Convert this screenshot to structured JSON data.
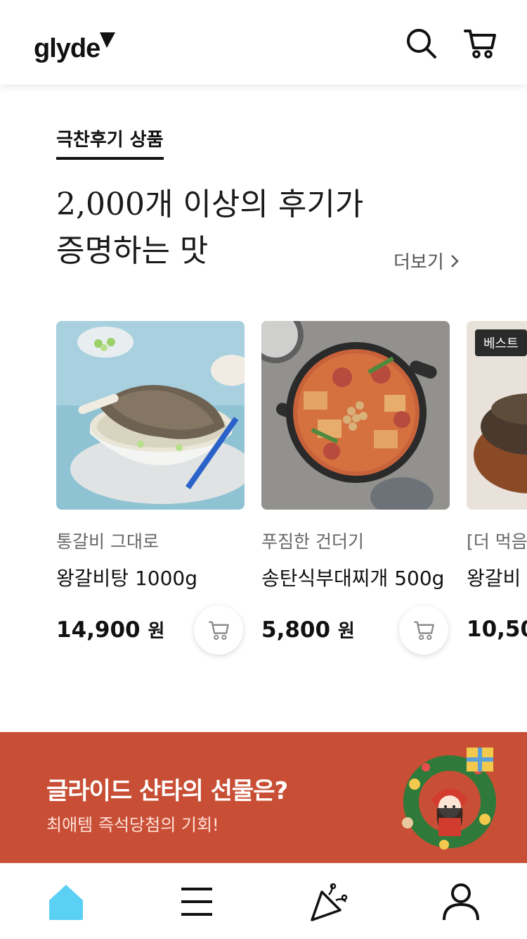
{
  "header": {
    "logo_text": "glyde",
    "icons": [
      "search-icon",
      "cart-icon"
    ]
  },
  "section": {
    "tag": "극찬후기 상품",
    "headline_line1": "2,000개 이상의 후기가",
    "headline_line2": "증명하는 맛",
    "more_label": "더보기"
  },
  "products": [
    {
      "subtitle": "통갈비 그대로",
      "name": "왕갈비탕 1000g",
      "price": "14,900",
      "currency": "원",
      "badge": ""
    },
    {
      "subtitle": "푸짐한 건더기",
      "name": "송탄식부대찌개 500g",
      "price": "5,800",
      "currency": "원",
      "badge": ""
    },
    {
      "subtitle": "[더 먹음",
      "name": "왕갈비",
      "price": "10,50",
      "currency": "",
      "badge": "베스트"
    }
  ],
  "banner": {
    "title": "글라이드 산타의 선물은?",
    "subtitle": "최애템 즉석당첨의 기회!",
    "color": "#c84f36"
  },
  "tabbar": {
    "items": [
      "home-icon",
      "menu-icon",
      "party-icon",
      "profile-icon"
    ],
    "active_color": "#5ad0f5"
  }
}
